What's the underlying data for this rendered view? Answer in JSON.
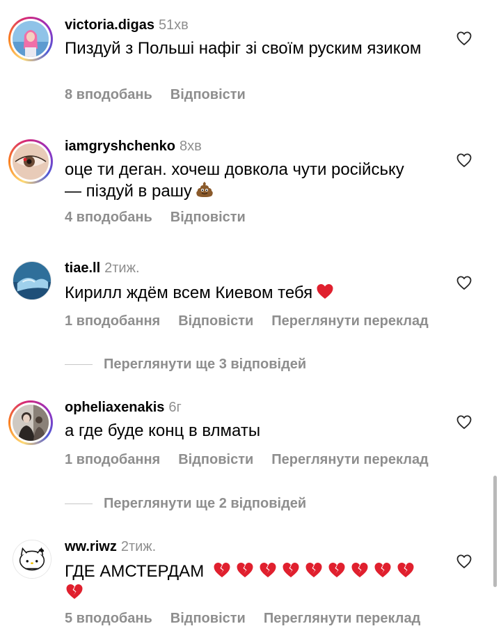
{
  "comments": [
    {
      "username": "victoria.digas",
      "time": "51хв",
      "text": "Пиздуй з Польші нафіг зі своїм руским язиком",
      "likes": "8 вподобань",
      "reply": "Відповісти",
      "translate": ""
    },
    {
      "username": "iamgryshchenko",
      "time": "8хв",
      "text_line1": "оце ти деган. хочеш довкола чути російську",
      "text_line2": "— піздуй в рашу",
      "emoji": "poop-emoji",
      "likes": "4 вподобань",
      "reply": "Відповісти"
    },
    {
      "username": "tiae.ll",
      "time": "2тиж.",
      "text": "Кирилл ждём всем Киевом тебя",
      "emoji": "red-heart-emoji",
      "likes": "1 вподобання",
      "reply": "Відповісти",
      "translate": "Переглянути переклад",
      "view_replies": "Переглянути ще 3 відповідей"
    },
    {
      "username": "opheliaxenakis",
      "time": "6г",
      "text": "а где буде конц в влматы",
      "likes": "1 вподобання",
      "reply": "Відповісти",
      "translate": "Переглянути переклад",
      "view_replies": "Переглянути ще 2 відповідей"
    },
    {
      "username": "ww.riwz",
      "time": "2тиж.",
      "text": "ГДЕ АМСТЕРДАМ",
      "emoji": "broken-heart-emoji",
      "emoji_count": 10,
      "likes": "5 вподобань",
      "reply": "Відповісти",
      "translate": "Переглянути переклад"
    }
  ],
  "colors": {
    "secondary_text": "#8e8e8e",
    "primary_text": "#000000",
    "heart_red": "#e0202e"
  },
  "icons": {
    "like": "heart-outline-icon"
  }
}
